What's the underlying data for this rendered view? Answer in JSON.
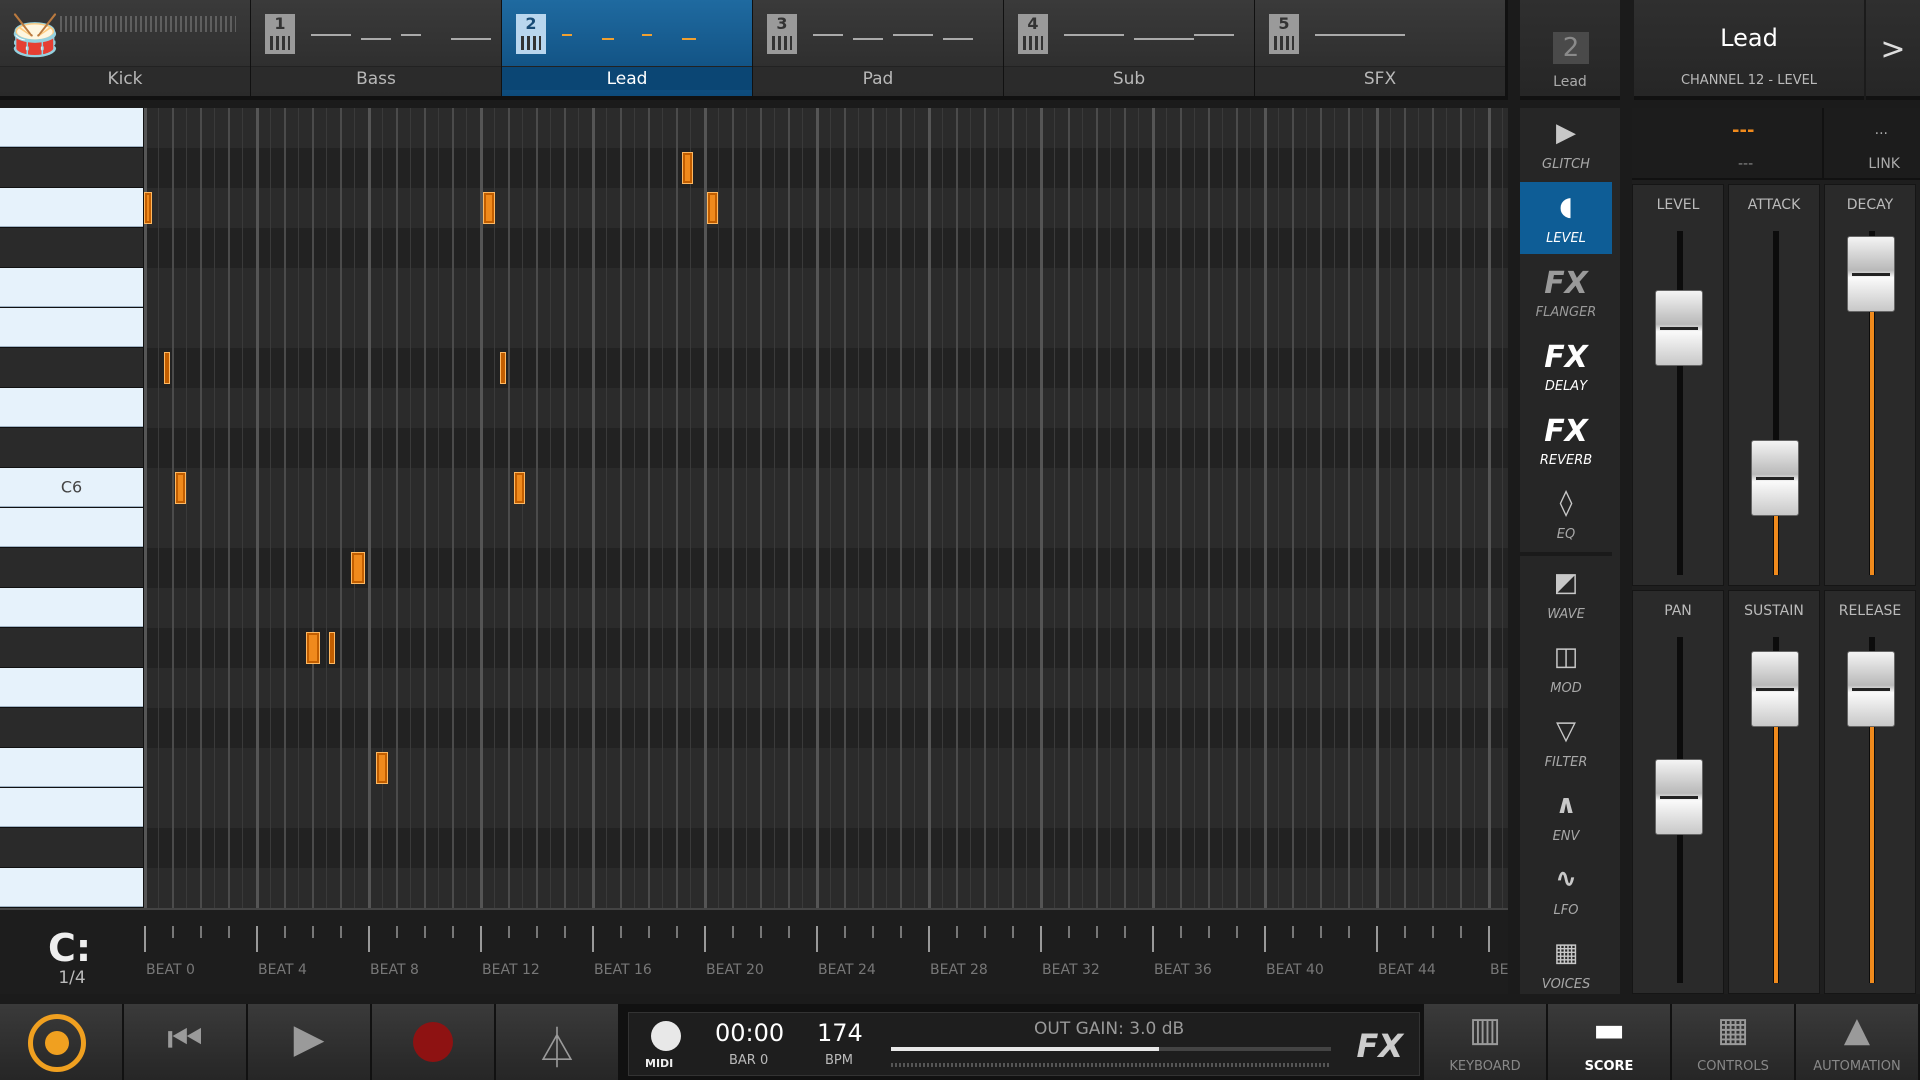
{
  "tracks": [
    {
      "label": "Kick",
      "num": "",
      "type": "drum"
    },
    {
      "label": "Bass",
      "num": "1",
      "type": "synth"
    },
    {
      "label": "Lead",
      "num": "2",
      "type": "synth",
      "active": true
    },
    {
      "label": "Pad",
      "num": "3",
      "type": "synth"
    },
    {
      "label": "Sub",
      "num": "4",
      "type": "synth"
    },
    {
      "label": "SFX",
      "num": "5",
      "type": "synth"
    }
  ],
  "channel": {
    "number": "2",
    "label": "Lead"
  },
  "title": {
    "name": "Lead",
    "sub": "CHANNEL 12 - LEVEL",
    "next": ">"
  },
  "piano": {
    "label_c6": "C6"
  },
  "snap": {
    "icon": "C:",
    "value": "1/4"
  },
  "ruler": {
    "labels": [
      "BEAT 0",
      "BEAT 4",
      "BEAT 8",
      "BEAT 12",
      "BEAT 16",
      "BEAT 20",
      "BEAT 24",
      "BEAT 28",
      "BEAT 32",
      "BEAT 36",
      "BEAT 40",
      "BEAT 44",
      "BE"
    ]
  },
  "tools": [
    {
      "label": "GLITCH",
      "icon": "glitch-icon",
      "glyph": "▶"
    },
    {
      "label": "LEVEL",
      "icon": "level-icon",
      "glyph": "◖",
      "active": true
    },
    {
      "label": "FLANGER",
      "icon": "fx-flanger-icon",
      "glyph": "FX",
      "fx": true,
      "dim": true
    },
    {
      "label": "DELAY",
      "icon": "fx-delay-icon",
      "glyph": "FX",
      "fx": true
    },
    {
      "label": "REVERB",
      "icon": "fx-reverb-icon",
      "glyph": "FX",
      "fx": true
    },
    {
      "label": "EQ",
      "icon": "eq-icon",
      "glyph": "◊"
    },
    {
      "label": "WAVE",
      "icon": "wave-icon",
      "glyph": "◩"
    },
    {
      "label": "MOD",
      "icon": "mod-icon",
      "glyph": "◫"
    },
    {
      "label": "FILTER",
      "icon": "filter-icon",
      "glyph": "▽"
    },
    {
      "label": "ENV",
      "icon": "env-icon",
      "glyph": "∧"
    },
    {
      "label": "LFO",
      "icon": "lfo-icon",
      "glyph": "∿"
    },
    {
      "label": "VOICES",
      "icon": "voices-icon",
      "glyph": "▦"
    }
  ],
  "mixer": {
    "top": {
      "value": "---",
      "sub": "---",
      "dots": "...",
      "link": "LINK"
    },
    "strips": [
      {
        "label": "LEVEL",
        "level": 0.78
      },
      {
        "label": "ATTACK",
        "level": 0.22
      },
      {
        "label": "DECAY",
        "level": 0.98
      },
      {
        "label": "PAN",
        "level": 0.55
      },
      {
        "label": "SUSTAIN",
        "level": 0.95
      },
      {
        "label": "RELEASE",
        "level": 0.95
      }
    ]
  },
  "transport": {
    "midi": "MIDI",
    "time": "00:00",
    "bar": "BAR 0",
    "bpm": "174",
    "bpm_label": "BPM",
    "gain_label": "OUT GAIN: 3.0 dB",
    "gain_level": 0.61,
    "fx": "FX"
  },
  "bottom_nav": [
    {
      "label": "KEYBOARD",
      "glyph": "▥"
    },
    {
      "label": "SCORE",
      "glyph": "▬",
      "active": true
    },
    {
      "label": "CONTROLS",
      "glyph": "▦"
    },
    {
      "label": "AUTOMATION",
      "glyph": "▲"
    }
  ],
  "notes": [
    {
      "beat": 0.0,
      "len": 0.3,
      "row": 2
    },
    {
      "beat": 0.7,
      "len": 0.15,
      "row": 6
    },
    {
      "beat": 1.1,
      "len": 0.4,
      "row": 9
    },
    {
      "beat": 5.8,
      "len": 0.5,
      "row": 13
    },
    {
      "beat": 6.6,
      "len": 0.15,
      "row": 13
    },
    {
      "beat": 7.4,
      "len": 0.5,
      "row": 11
    },
    {
      "beat": 8.3,
      "len": 0.4,
      "row": 16
    },
    {
      "beat": 12.1,
      "len": 0.45,
      "row": 2
    },
    {
      "beat": 12.7,
      "len": 0.15,
      "row": 6
    },
    {
      "beat": 13.2,
      "len": 0.4,
      "row": 9
    },
    {
      "beat": 19.2,
      "len": 0.4,
      "row": 1
    },
    {
      "beat": 20.1,
      "len": 0.4,
      "row": 2
    }
  ]
}
